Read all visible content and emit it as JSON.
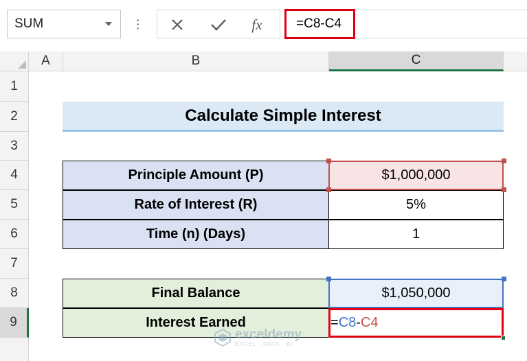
{
  "formula_bar": {
    "name_box": "SUM",
    "formula": "=C8-C4",
    "fx_label": "fx",
    "icons": {
      "cancel": "x-icon",
      "enter": "checkmark-icon",
      "function": "fx-icon",
      "name_box_dropdown": "chevron-down-icon"
    }
  },
  "columns": [
    "A",
    "B",
    "C"
  ],
  "selected_column": "C",
  "rows": [
    "1",
    "2",
    "3",
    "4",
    "5",
    "6",
    "7",
    "8",
    "9"
  ],
  "selected_row": "9",
  "sheet": {
    "title": "Calculate Simple Interest",
    "inputs": [
      {
        "label": "Principle Amount (P)",
        "value": "$1,000,000"
      },
      {
        "label": "Rate of Interest (R)",
        "value": "5%"
      },
      {
        "label": "Time (n) (Days)",
        "value": "1"
      }
    ],
    "outputs": [
      {
        "label": "Final Balance",
        "value": "$1,050,000"
      },
      {
        "label": "Interest Earned"
      }
    ],
    "editing_formula": {
      "eq": "=",
      "ref1": "C8",
      "op": "-",
      "ref2": "C4"
    }
  },
  "watermark": {
    "name": "exceldemy",
    "tagline": "EXCEL · DATA · BI"
  },
  "colors": {
    "accent_green": "#217346",
    "highlight_red": "#e0000f",
    "ref_blue": "#4472c4",
    "ref_red": "#c0504d",
    "input_label_fill": "#d9e1f2",
    "output_label_fill": "#e2efda",
    "title_fill": "#dbe9f5"
  }
}
